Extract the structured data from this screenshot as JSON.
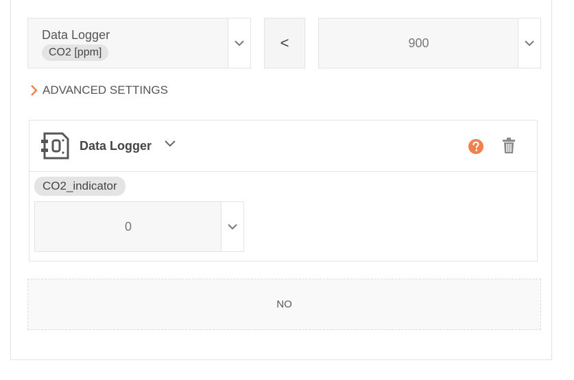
{
  "condition": {
    "source_label": "Data Logger",
    "source_variable": "CO2 [ppm]",
    "operator": "<",
    "threshold": "900"
  },
  "advanced": {
    "label": "ADVANCED SETTINGS"
  },
  "action": {
    "device_label": "Data Logger",
    "variable": "CO2_indicator",
    "value": "0"
  },
  "else_block": {
    "label": "NO"
  },
  "colors": {
    "accent": "#f0814e",
    "help": "#f0814e",
    "icon_gray": "#8a8a8a"
  },
  "icons": {
    "dropdown": "chevron-down-icon",
    "advanced": "chevron-right-icon",
    "device": "data-logger-icon",
    "help": "help-icon",
    "delete": "trash-icon"
  }
}
